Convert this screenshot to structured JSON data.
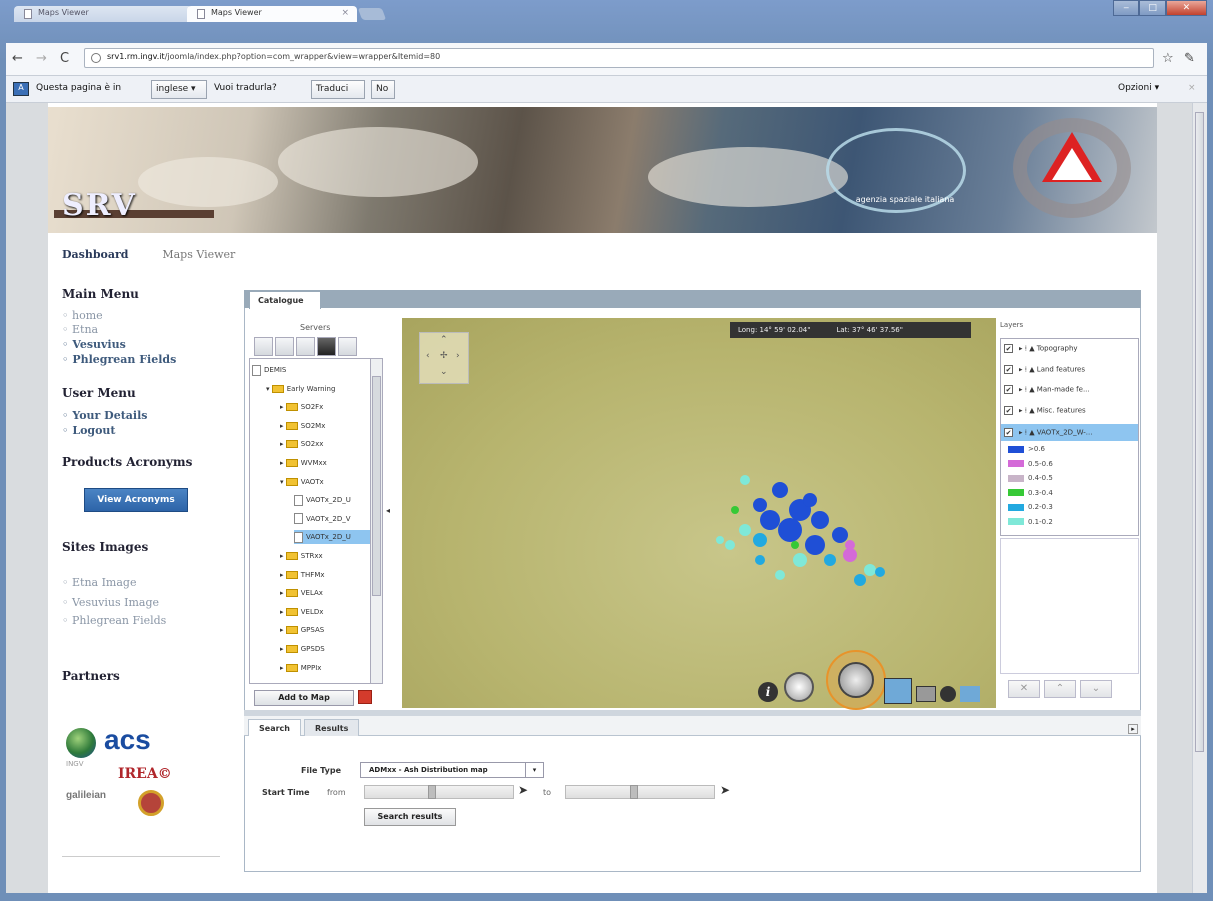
{
  "browser": {
    "tabs": [
      {
        "title": "Maps Viewer"
      },
      {
        "title": "Maps Viewer"
      }
    ],
    "url_host": "srv1.rm.ingv.it",
    "url_path": "/joomla/index.php?option=com_wrapper&view=wrapper&Itemid=80"
  },
  "translate_bar": {
    "prompt": "Questa pagina è in",
    "language": "inglese",
    "question": "Vuoi tradurla?",
    "translate_btn": "Traduci",
    "no_btn": "No",
    "options": "Opzioni"
  },
  "banner": {
    "logo": "SRV",
    "asi_text": "agenzia spaziale italiana",
    "pcn_text": "PROTEZIONE CIVILE NAZIONALE"
  },
  "breadcrumbs": [
    "Dashboard",
    "Maps Viewer"
  ],
  "sidebar": {
    "main_menu_title": "Main Menu",
    "main_menu": [
      "home",
      "Etna",
      "Vesuvius",
      "Phlegrean Fields"
    ],
    "user_menu_title": "User Menu",
    "user_menu": [
      "Your Details",
      "Logout"
    ],
    "products_title": "Products Acronyms",
    "view_acronyms": "View Acronyms",
    "sites_title": "Sites Images",
    "sites": [
      "Etna Image",
      "Vesuvius Image",
      "Phlegrean Fields"
    ],
    "partners_title": "Partners",
    "partners": {
      "acs": "acs",
      "ingv": "INGV",
      "irea": "IREA",
      "galileian": "galileian"
    }
  },
  "catalogue": {
    "tab": "Catalogue",
    "servers_title": "Servers",
    "tree": [
      {
        "label": "DEMIS",
        "kind": "doc"
      },
      {
        "label": "Early Warning",
        "kind": "folder-open"
      },
      {
        "label": "SO2Fx",
        "kind": "folder"
      },
      {
        "label": "SO2Mx",
        "kind": "folder"
      },
      {
        "label": "SO2xx",
        "kind": "folder"
      },
      {
        "label": "WVMxx",
        "kind": "folder"
      },
      {
        "label": "VAOTx",
        "kind": "folder-open"
      },
      {
        "label": "VAOTx_2D_U",
        "kind": "doc"
      },
      {
        "label": "VAOTx_2D_V",
        "kind": "doc"
      },
      {
        "label": "VAOTx_2D_U",
        "kind": "doc-selected"
      },
      {
        "label": "STRxx",
        "kind": "folder"
      },
      {
        "label": "THFMx",
        "kind": "folder"
      },
      {
        "label": "VELAx",
        "kind": "folder"
      },
      {
        "label": "VELDx",
        "kind": "folder"
      },
      {
        "label": "GPSAS",
        "kind": "folder"
      },
      {
        "label": "GPSDS",
        "kind": "folder"
      },
      {
        "label": "MPPIx",
        "kind": "folder"
      }
    ],
    "add_to_map": "Add to Map"
  },
  "map": {
    "long": "Long: 14° 59' 02.04\"",
    "lat": "Lat: 37° 46' 37.56\""
  },
  "layers": {
    "title": "Layers",
    "items": [
      "Topography",
      "Land features",
      "Man-made fe...",
      "Misc. features",
      "VAOTx_2D_W-..."
    ],
    "legend": [
      {
        "label": ">0.6",
        "color": "#1f4fd6"
      },
      {
        "label": "0.5-0.6",
        "color": "#d46ad8"
      },
      {
        "label": "0.4-0.5",
        "color": "#c8b4c8"
      },
      {
        "label": "0.3-0.4",
        "color": "#36c936"
      },
      {
        "label": "0.2-0.3",
        "color": "#22a9e0"
      },
      {
        "label": "0.1-0.2",
        "color": "#7fe8d8"
      }
    ]
  },
  "search": {
    "tabs": [
      "Search",
      "Results"
    ],
    "file_type_label": "File Type",
    "file_type_value": "ADMxx - Ash Distribution map",
    "start_time_label": "Start Time",
    "from": "from",
    "to": "to",
    "search_btn": "Search results"
  }
}
